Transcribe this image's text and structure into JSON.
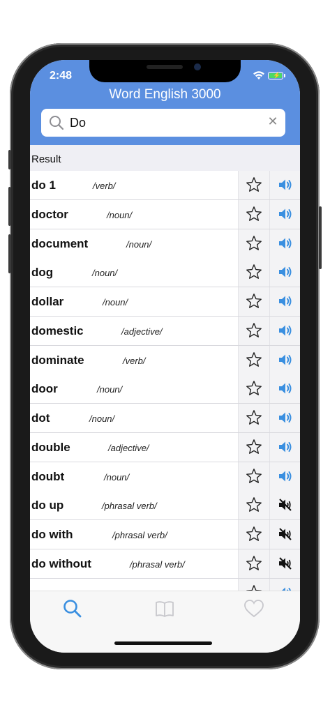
{
  "status_bar": {
    "time": "2:48"
  },
  "header": {
    "title": "Word English 3000"
  },
  "search": {
    "value": "Do"
  },
  "result_label": "Result",
  "words": [
    {
      "word": "do 1",
      "type": "/verb/",
      "sound": "on"
    },
    {
      "word": "doctor",
      "type": "/noun/",
      "sound": "on"
    },
    {
      "word": "document",
      "type": "/noun/",
      "sound": "on"
    },
    {
      "word": "dog",
      "type": "/noun/",
      "sound": "on"
    },
    {
      "word": "dollar",
      "type": "/noun/",
      "sound": "on"
    },
    {
      "word": "domestic",
      "type": "/adjective/",
      "sound": "on"
    },
    {
      "word": "dominate",
      "type": "/verb/",
      "sound": "on"
    },
    {
      "word": "door",
      "type": "/noun/",
      "sound": "on"
    },
    {
      "word": "dot",
      "type": "/noun/",
      "sound": "on"
    },
    {
      "word": "double",
      "type": "/adjective/",
      "sound": "on"
    },
    {
      "word": "doubt",
      "type": "/noun/",
      "sound": "on"
    },
    {
      "word": "do up",
      "type": "/phrasal verb/",
      "sound": "muted"
    },
    {
      "word": "do with",
      "type": "/phrasal verb/",
      "sound": "muted"
    },
    {
      "word": "do without",
      "type": "/phrasal verb/",
      "sound": "muted"
    },
    {
      "word": "",
      "type": "",
      "sound": "on"
    }
  ],
  "tabs": [
    {
      "icon": "search-icon",
      "active": true
    },
    {
      "icon": "book-icon",
      "active": false
    },
    {
      "icon": "heart-icon",
      "active": false
    }
  ],
  "colors": {
    "header": "#5b8fe0",
    "accent": "#3a8fe0",
    "inactive": "#c7c7cc"
  }
}
